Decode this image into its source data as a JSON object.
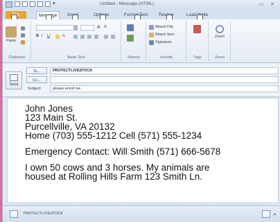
{
  "window": {
    "title": "Untitled - Message (HTML)",
    "controls": "▭ ✕"
  },
  "tabs": [
    {
      "label": "File"
    },
    {
      "label": "Message"
    },
    {
      "label": "Insert"
    },
    {
      "label": "Options"
    },
    {
      "label": "Format Text"
    },
    {
      "label": "Review"
    },
    {
      "label": "Load Write"
    }
  ],
  "ribbon": {
    "clipboard": {
      "label": "Clipboard",
      "paste": "Paste"
    },
    "basic_text": {
      "label": "Basic Text"
    },
    "names": {
      "label": "Names"
    },
    "include": {
      "label": "Include",
      "attach_file": "Attach File",
      "attach_item": "Attach Item",
      "signature": "Signature"
    },
    "tags": {
      "label": "Tags"
    },
    "zoom": {
      "label": "Zoom",
      "zoom_btn": "Zoom"
    }
  },
  "header": {
    "send_label": "Send",
    "to_label": "To...",
    "to_value": "PROTECTLIVESTOCK",
    "cc_label": "Cc...",
    "cc_value": "",
    "subject_label": "Subject:",
    "subject_value": "please enroll me"
  },
  "body": {
    "lines": [
      "John Jones",
      "123 Main St.",
      "Purcellville, VA 20132",
      "Home (703) 555-1212 Cell (571) 555-1234",
      "",
      "Emergency Contact: Will Smith (571) 666-5678",
      "",
      "I own 50 cows and 3 horses.  My animals are",
      "housed at Rolling Hills Farm 123 Smith Ln."
    ]
  },
  "people_pane": {
    "name": "PROTECTLIVESTOCK"
  },
  "colors": {
    "accent_pink": "#e06a93",
    "file_tab": "#e8a33a",
    "ribbon_bg": "#e4ebf4"
  }
}
